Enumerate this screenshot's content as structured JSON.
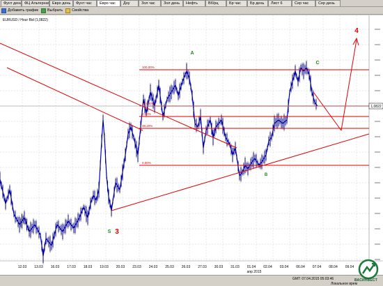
{
  "tabs": [
    {
      "label": "Фунт день"
    },
    {
      "label": "ФЦ Альтернатива"
    },
    {
      "label": "Евро день"
    },
    {
      "label": "Фунт час"
    },
    {
      "label": "Евро час"
    },
    {
      "label": "Доу"
    },
    {
      "label": "Зол час"
    },
    {
      "label": "Зол день"
    },
    {
      "label": "Нефть"
    },
    {
      "label": "Вб/рц"
    },
    {
      "label": "Бр час"
    },
    {
      "label": "Бр день"
    },
    {
      "label": "Лист 6"
    },
    {
      "label": "Сер час"
    },
    {
      "label": "Сер день"
    }
  ],
  "active_tab": 4,
  "toolbar": {
    "add_chart": "Добавить график",
    "select": "Выбрать",
    "properties": "Свойства"
  },
  "chart_header": "EURUSD / Hour Bid (1,0822)",
  "current_price": "1,0822",
  "wave_labels": [
    {
      "text": "4",
      "color": "#e00000"
    },
    {
      "text": "A",
      "color": "#1a8a1a"
    },
    {
      "text": "C",
      "color": "#1a8a1a"
    },
    {
      "text": "B",
      "color": "#1a8a1a"
    },
    {
      "text": "S",
      "color": "#1a8a1a"
    },
    {
      "text": "3",
      "color": "#e00000"
    }
  ],
  "fib_labels": [
    "100,00%",
    "161,80%",
    "0,00%",
    "38,20%",
    "0,00%"
  ],
  "x_ticks": [
    "12.03",
    "13.03",
    "16.03",
    "17.03",
    "18.03",
    "19.03",
    "20.03",
    "23.03",
    "24.03",
    "25.03",
    "26.03",
    "27.03",
    "30.03",
    "31.03",
    "01.04",
    "02.04",
    "03.04",
    "06.04",
    "07.04",
    "08.04",
    "09.04"
  ],
  "x_sublabel": "апр 2015",
  "status": {
    "time": "GMT: 07.04.2015 05:03:46",
    "local": "Локальное врем"
  },
  "logo_text": "ВАСИНВЕСТ",
  "colors": {
    "candles": "#0000cc",
    "lines": "#e00000",
    "grid": "#c8c8c8"
  }
}
